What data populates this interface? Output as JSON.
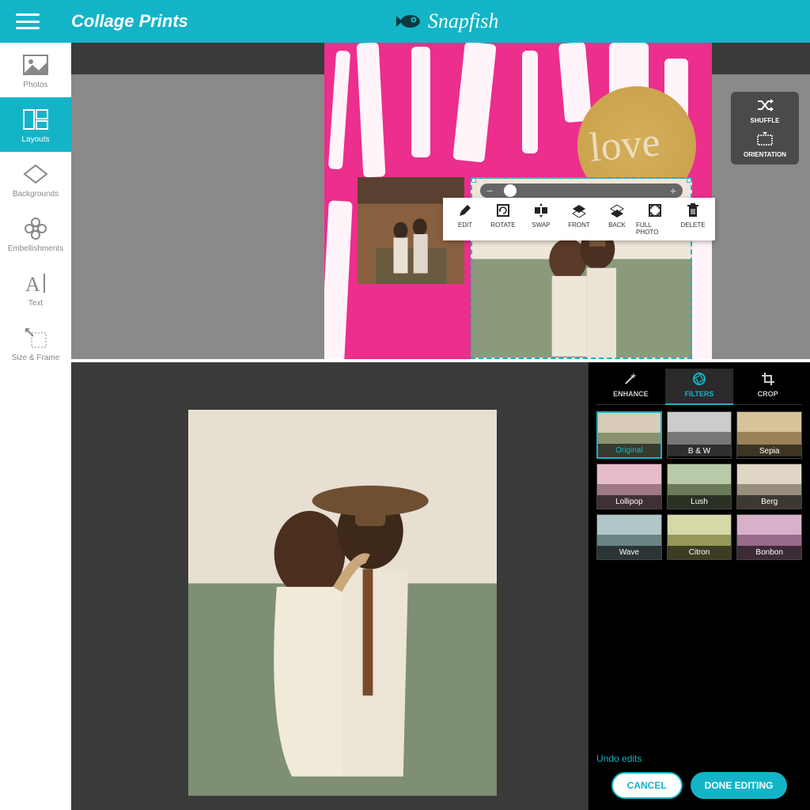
{
  "header": {
    "title": "Collage Prints",
    "brand": "Snapfish"
  },
  "sidebar": {
    "items": [
      {
        "label": "Photos",
        "icon": "photos-icon"
      },
      {
        "label": "Layouts",
        "icon": "layouts-icon"
      },
      {
        "label": "Backgrounds",
        "icon": "backgrounds-icon"
      },
      {
        "label": "Embellishments",
        "icon": "embellishments-icon"
      },
      {
        "label": "Text",
        "icon": "text-icon"
      },
      {
        "label": "Size & Frame",
        "icon": "size-frame-icon"
      }
    ]
  },
  "collage_toolbar": {
    "items": [
      {
        "label": "EDIT",
        "icon": "pencil-icon"
      },
      {
        "label": "ROTATE",
        "icon": "rotate-icon"
      },
      {
        "label": "SWAP",
        "icon": "swap-icon"
      },
      {
        "label": "FRONT",
        "icon": "front-icon"
      },
      {
        "label": "BACK",
        "icon": "back-icon"
      },
      {
        "label": "FULL PHOTO",
        "icon": "fullphoto-icon"
      },
      {
        "label": "DELETE",
        "icon": "trash-icon"
      }
    ]
  },
  "side_panel": {
    "items": [
      {
        "label": "SHUFFLE",
        "icon": "shuffle-icon"
      },
      {
        "label": "ORIENTATION",
        "icon": "orientation-icon"
      }
    ]
  },
  "collage_overlay_text": "love",
  "editor_tabs": {
    "items": [
      {
        "label": "ENHANCE",
        "icon": "wand-icon"
      },
      {
        "label": "FILTERS",
        "icon": "aperture-icon"
      },
      {
        "label": "CROP",
        "icon": "crop-icon"
      }
    ],
    "active": 1
  },
  "filters": {
    "items": [
      {
        "label": "Original"
      },
      {
        "label": "B & W"
      },
      {
        "label": "Sepia"
      },
      {
        "label": "Lollipop"
      },
      {
        "label": "Lush"
      },
      {
        "label": "Berg"
      },
      {
        "label": "Wave"
      },
      {
        "label": "Citron"
      },
      {
        "label": "Bonbon"
      }
    ],
    "active": 0
  },
  "undo_label": "Undo edits",
  "buttons": {
    "cancel": "CANCEL",
    "done": "DONE EDITING"
  },
  "colors": {
    "accent": "#14b4c8",
    "collage_bg": "#ec2e8d"
  }
}
